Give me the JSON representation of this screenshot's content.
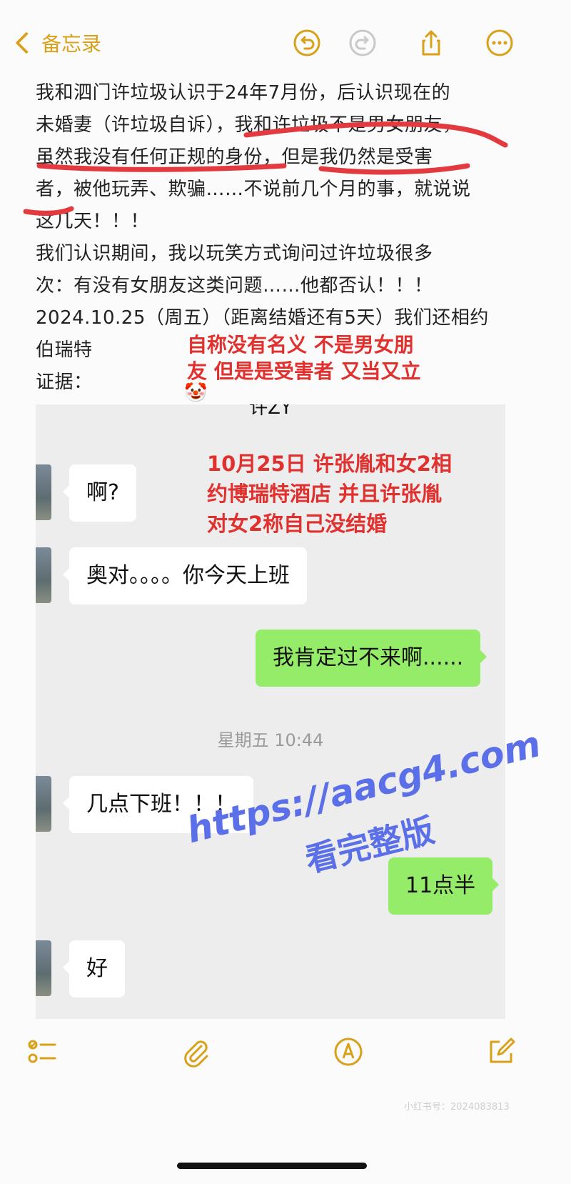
{
  "nav": {
    "back_label": "备忘录"
  },
  "note_lines": [
    "我和泗门许垃圾认识于24年7月份，后认识现在的",
    "未婚妻（许垃圾自诉），我和许垃圾不是男女朋友，",
    "虽然我没有任何正规的身份，但是我仍然是受害",
    "者，被他玩弄、欺骗……不说前几个月的事，就说说",
    "这几天！！！",
    "我们认识期间，我以玩笑方式询问过许垃圾很多",
    "次：有没有女朋友这类问题……他都否认！！！",
    "2024.10.25（周五）（距离结婚还有5天）我们还相约",
    "伯瑞特",
    "证据："
  ],
  "red_annotation_1": {
    "line1": "自称没有名义 不是男女朋",
    "line2": "友 但是是受害者 又当又立",
    "emoji": "🤡"
  },
  "chat": {
    "title": "许ZY",
    "annotation": {
      "line1": "10月25日 许张胤和女2相",
      "line2": "约博瑞特酒店 并且许张胤",
      "line3": "对女2称自己没结婚"
    },
    "messages": [
      {
        "side": "left",
        "text": "啊?"
      },
      {
        "side": "left",
        "text": "奥对。。。。你今天上班"
      },
      {
        "side": "right",
        "text": "我肯定过不来啊......"
      },
      {
        "side": "time",
        "text": "星期五 10:44"
      },
      {
        "side": "left",
        "text": "几点下班！！！"
      },
      {
        "side": "right",
        "text": "11点半"
      },
      {
        "side": "left",
        "text": "好"
      }
    ]
  },
  "watermark": {
    "url": "https://aacg4.com",
    "subtitle": "看完整版"
  },
  "footer_mark": "小红书号：2024083813",
  "colors": {
    "accent": "#d9a11a",
    "annotation_red": "#e0312f",
    "bubble_me": "#95ec69",
    "watermark": "#5b6fe8"
  },
  "icons": [
    "chevron-left-icon",
    "undo-icon",
    "redo-icon",
    "share-icon",
    "more-icon",
    "checklist-icon",
    "paperclip-icon",
    "markup-icon",
    "compose-icon"
  ]
}
